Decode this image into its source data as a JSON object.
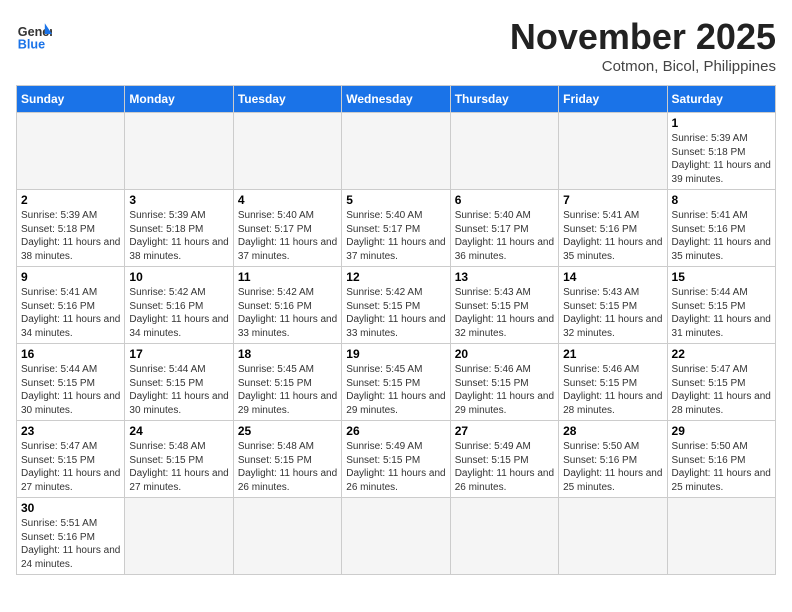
{
  "header": {
    "logo_text_general": "General",
    "logo_text_blue": "Blue",
    "title": "November 2025",
    "subtitle": "Cotmon, Bicol, Philippines"
  },
  "days_of_week": [
    "Sunday",
    "Monday",
    "Tuesday",
    "Wednesday",
    "Thursday",
    "Friday",
    "Saturday"
  ],
  "weeks": [
    [
      {
        "day": "",
        "empty": true
      },
      {
        "day": "",
        "empty": true
      },
      {
        "day": "",
        "empty": true
      },
      {
        "day": "",
        "empty": true
      },
      {
        "day": "",
        "empty": true
      },
      {
        "day": "",
        "empty": true
      },
      {
        "day": "1",
        "sunrise": "5:39 AM",
        "sunset": "5:18 PM",
        "daylight": "11 hours and 39 minutes."
      }
    ],
    [
      {
        "day": "2",
        "sunrise": "5:39 AM",
        "sunset": "5:18 PM",
        "daylight": "11 hours and 38 minutes."
      },
      {
        "day": "3",
        "sunrise": "5:39 AM",
        "sunset": "5:18 PM",
        "daylight": "11 hours and 38 minutes."
      },
      {
        "day": "4",
        "sunrise": "5:40 AM",
        "sunset": "5:17 PM",
        "daylight": "11 hours and 37 minutes."
      },
      {
        "day": "5",
        "sunrise": "5:40 AM",
        "sunset": "5:17 PM",
        "daylight": "11 hours and 37 minutes."
      },
      {
        "day": "6",
        "sunrise": "5:40 AM",
        "sunset": "5:17 PM",
        "daylight": "11 hours and 36 minutes."
      },
      {
        "day": "7",
        "sunrise": "5:41 AM",
        "sunset": "5:16 PM",
        "daylight": "11 hours and 35 minutes."
      },
      {
        "day": "8",
        "sunrise": "5:41 AM",
        "sunset": "5:16 PM",
        "daylight": "11 hours and 35 minutes."
      }
    ],
    [
      {
        "day": "9",
        "sunrise": "5:41 AM",
        "sunset": "5:16 PM",
        "daylight": "11 hours and 34 minutes."
      },
      {
        "day": "10",
        "sunrise": "5:42 AM",
        "sunset": "5:16 PM",
        "daylight": "11 hours and 34 minutes."
      },
      {
        "day": "11",
        "sunrise": "5:42 AM",
        "sunset": "5:16 PM",
        "daylight": "11 hours and 33 minutes."
      },
      {
        "day": "12",
        "sunrise": "5:42 AM",
        "sunset": "5:15 PM",
        "daylight": "11 hours and 33 minutes."
      },
      {
        "day": "13",
        "sunrise": "5:43 AM",
        "sunset": "5:15 PM",
        "daylight": "11 hours and 32 minutes."
      },
      {
        "day": "14",
        "sunrise": "5:43 AM",
        "sunset": "5:15 PM",
        "daylight": "11 hours and 32 minutes."
      },
      {
        "day": "15",
        "sunrise": "5:44 AM",
        "sunset": "5:15 PM",
        "daylight": "11 hours and 31 minutes."
      }
    ],
    [
      {
        "day": "16",
        "sunrise": "5:44 AM",
        "sunset": "5:15 PM",
        "daylight": "11 hours and 30 minutes."
      },
      {
        "day": "17",
        "sunrise": "5:44 AM",
        "sunset": "5:15 PM",
        "daylight": "11 hours and 30 minutes."
      },
      {
        "day": "18",
        "sunrise": "5:45 AM",
        "sunset": "5:15 PM",
        "daylight": "11 hours and 29 minutes."
      },
      {
        "day": "19",
        "sunrise": "5:45 AM",
        "sunset": "5:15 PM",
        "daylight": "11 hours and 29 minutes."
      },
      {
        "day": "20",
        "sunrise": "5:46 AM",
        "sunset": "5:15 PM",
        "daylight": "11 hours and 29 minutes."
      },
      {
        "day": "21",
        "sunrise": "5:46 AM",
        "sunset": "5:15 PM",
        "daylight": "11 hours and 28 minutes."
      },
      {
        "day": "22",
        "sunrise": "5:47 AM",
        "sunset": "5:15 PM",
        "daylight": "11 hours and 28 minutes."
      }
    ],
    [
      {
        "day": "23",
        "sunrise": "5:47 AM",
        "sunset": "5:15 PM",
        "daylight": "11 hours and 27 minutes."
      },
      {
        "day": "24",
        "sunrise": "5:48 AM",
        "sunset": "5:15 PM",
        "daylight": "11 hours and 27 minutes."
      },
      {
        "day": "25",
        "sunrise": "5:48 AM",
        "sunset": "5:15 PM",
        "daylight": "11 hours and 26 minutes."
      },
      {
        "day": "26",
        "sunrise": "5:49 AM",
        "sunset": "5:15 PM",
        "daylight": "11 hours and 26 minutes."
      },
      {
        "day": "27",
        "sunrise": "5:49 AM",
        "sunset": "5:15 PM",
        "daylight": "11 hours and 26 minutes."
      },
      {
        "day": "28",
        "sunrise": "5:50 AM",
        "sunset": "5:16 PM",
        "daylight": "11 hours and 25 minutes."
      },
      {
        "day": "29",
        "sunrise": "5:50 AM",
        "sunset": "5:16 PM",
        "daylight": "11 hours and 25 minutes."
      }
    ],
    [
      {
        "day": "30",
        "sunrise": "5:51 AM",
        "sunset": "5:16 PM",
        "daylight": "11 hours and 24 minutes."
      },
      {
        "day": "",
        "empty": true
      },
      {
        "day": "",
        "empty": true
      },
      {
        "day": "",
        "empty": true
      },
      {
        "day": "",
        "empty": true
      },
      {
        "day": "",
        "empty": true
      },
      {
        "day": "",
        "empty": true
      }
    ]
  ]
}
